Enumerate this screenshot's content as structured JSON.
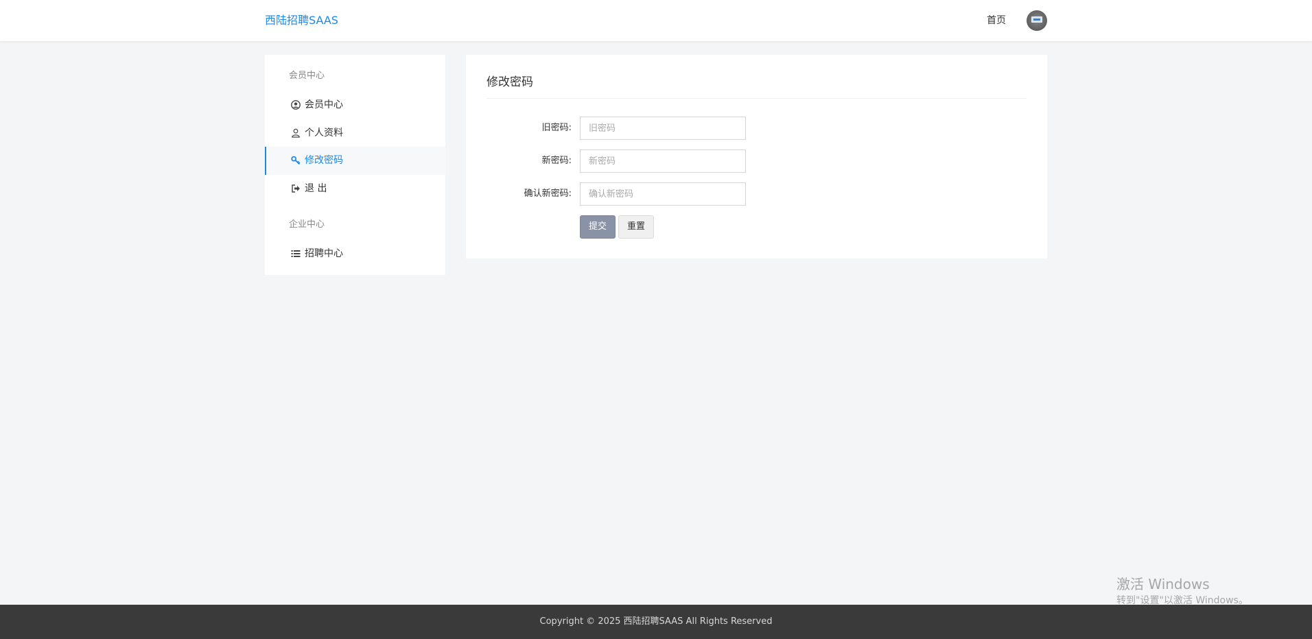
{
  "header": {
    "brand": "西陆招聘SAAS",
    "home_link": "首页"
  },
  "sidebar": {
    "groups": [
      {
        "title": "会员中心",
        "items": [
          {
            "label": "会员中心",
            "icon": "user-circle-icon",
            "active": false
          },
          {
            "label": "个人资料",
            "icon": "user-outline-icon",
            "active": false
          },
          {
            "label": "修改密码",
            "icon": "key-icon",
            "active": true
          },
          {
            "label": "退 出",
            "icon": "sign-out-icon",
            "active": false
          }
        ]
      },
      {
        "title": "企业中心",
        "items": [
          {
            "label": "招聘中心",
            "icon": "list-icon",
            "active": false
          }
        ]
      }
    ]
  },
  "main": {
    "title": "修改密码",
    "fields": [
      {
        "label": "旧密码:",
        "placeholder": "旧密码",
        "value": ""
      },
      {
        "label": "新密码:",
        "placeholder": "新密码",
        "value": ""
      },
      {
        "label": "确认新密码:",
        "placeholder": "确认新密码",
        "value": ""
      }
    ],
    "submit_label": "提交",
    "reset_label": "重置"
  },
  "footer": {
    "copyright": "Copyright © 2025 西陆招聘SAAS All Rights Reserved"
  },
  "watermark": {
    "line1": "激活 Windows",
    "line2": "转到\"设置\"以激活 Windows。"
  },
  "colors": {
    "accent": "#1e88e5",
    "submit_button": "#8a93a6",
    "footer_bg": "#3a3a3a",
    "page_bg": "#f4f5f7"
  }
}
